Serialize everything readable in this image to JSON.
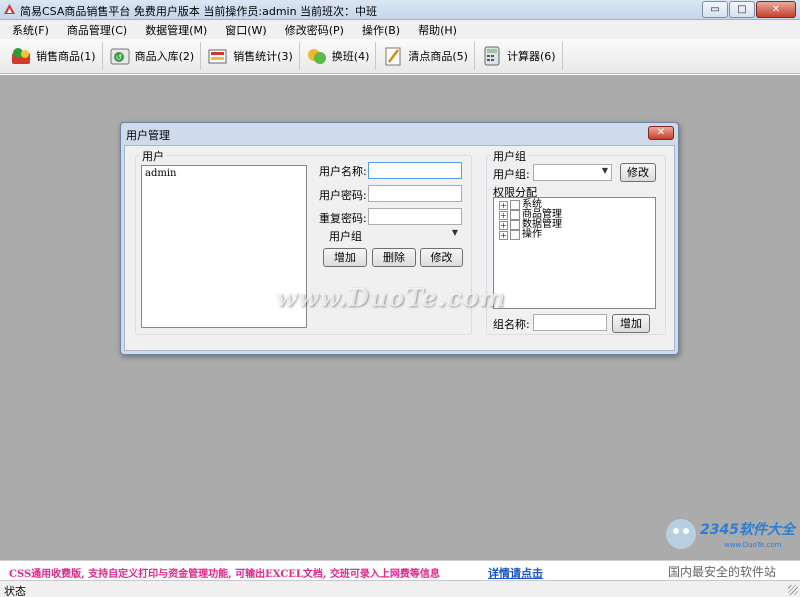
{
  "window": {
    "title": "简易CSA商品销售平台 免费用户版本 当前操作员:admin 当前班次：中班",
    "min_glyph": "▭",
    "max_glyph": "□",
    "close_glyph": "✕"
  },
  "menubar": {
    "items": [
      "系统(F)",
      "商品管理(C)",
      "数据管理(M)",
      "窗口(W)",
      "修改密码(P)",
      "操作(B)",
      "帮助(H)"
    ]
  },
  "toolbar": {
    "buttons": [
      {
        "label": "销售商品(1)",
        "icon": "sell-goods-icon"
      },
      {
        "label": "商品入库(2)",
        "icon": "stock-in-icon"
      },
      {
        "label": "销售统计(3)",
        "icon": "sales-stats-icon"
      },
      {
        "label": "换班(4)",
        "icon": "shift-change-icon"
      },
      {
        "label": "清点商品(5)",
        "icon": "inventory-icon"
      },
      {
        "label": "计算器(6)",
        "icon": "calculator-icon"
      }
    ]
  },
  "dialog": {
    "title": "用户管理",
    "close_glyph": "✕",
    "users_group": {
      "title": "用户",
      "items": [
        "admin"
      ]
    },
    "form": {
      "username_label": "用户名称:",
      "password_label": "用户密码:",
      "repeat_password_label": "重复密码:",
      "group_label": "用户组",
      "add_button": "增加",
      "delete_button": "删除",
      "modify_button": "修改",
      "combo_arrow": "▼"
    },
    "group_panel": {
      "title": "用户组",
      "group_label": "用户组:",
      "modify_button": "修改",
      "permission_label": "权限分配",
      "permissions": [
        "系统",
        "商品管理",
        "数据管理",
        "操作"
      ],
      "expander_glyph": "+",
      "group_name_label": "组名称:",
      "add_button": "增加",
      "combo_arrow": "▼"
    }
  },
  "watermark": {
    "text": "www.DuoTe.com",
    "brand": "2345软件大全",
    "site": "www.DuoTe.com"
  },
  "adbar": {
    "text": "CSS通用收费版, 支持自定义打印与资金管理功能, 可输出EXCEL文档, 交班可录入上网费等信息",
    "link": "详情请点击",
    "slogan": "国内最安全的软件站"
  },
  "statusbar": {
    "text": "状态"
  }
}
